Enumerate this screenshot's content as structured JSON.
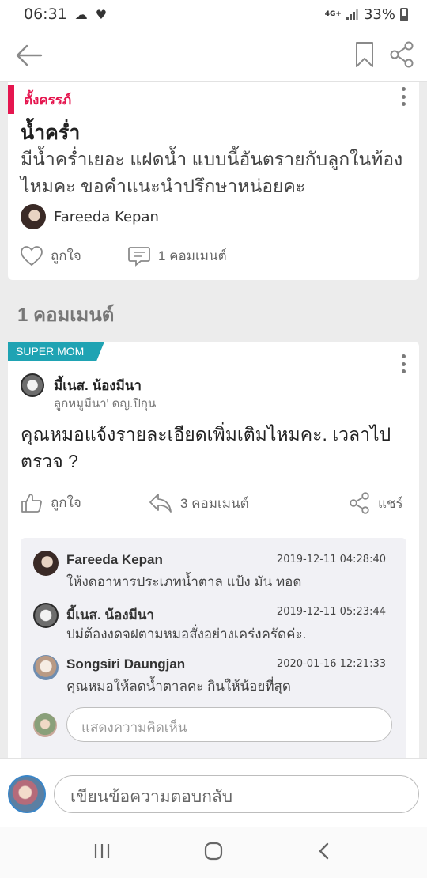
{
  "status_bar": {
    "time": "06:31",
    "battery": "33%",
    "network": "4G+"
  },
  "post": {
    "category": "ตั้งครรภ์",
    "title": "น้ำคร่ำ",
    "body": "มีน้ำคร่ำเยอะ แฝดน้ำ แบบนี้อันตรายกับลูกในท้องไหมคะ ขอคำแนะนำปรึกษาหน่อยคะ",
    "author": "Fareeda Kepan",
    "like_label": "ถูกใจ",
    "comment_label": "1 คอมเมนต์"
  },
  "comments_heading": "1 คอมเมนต์",
  "comment": {
    "badge": "SUPER MOM",
    "author": "มี้เนส. น้องมีนา",
    "subtitle": "ลูกหมูมีนา' ดญ.ปีกุน",
    "text": "คุณหมอแจ้งรายละเอียดเพิ่มเติมไหมคะ. เวลาไปตรวจ ?",
    "like_label": "ถูกใจ",
    "reply_label": "3 คอมเมนต์",
    "share_label": "แชร์"
  },
  "replies": [
    {
      "name": "Fareeda Kepan",
      "time": "2019-12-11 04:28:40",
      "text": "ให้งดอาหารประเภทน้ำตาล แป้ง มัน ทอด"
    },
    {
      "name": "มี้เนส. น้องมีนา",
      "time": "2019-12-11 05:23:44",
      "text": "ปม่ต้องงดจฝตามหมอสั่งอย่างเคร่งครัดค่ะ."
    },
    {
      "name": "Songsiri Daungjan",
      "time": "2020-01-16 12:21:33",
      "text": "คุณหมอให้ลดน้ำตาลคะ กินให้น้อยที่สุด"
    }
  ],
  "reply_placeholder": "แสดงความคิดเห็น",
  "compose_placeholder": "เขียนข้อความตอบกลับ",
  "colors": {
    "accent": "#e5164f",
    "badge": "#1fa3b3",
    "link_gray": "#666666"
  }
}
